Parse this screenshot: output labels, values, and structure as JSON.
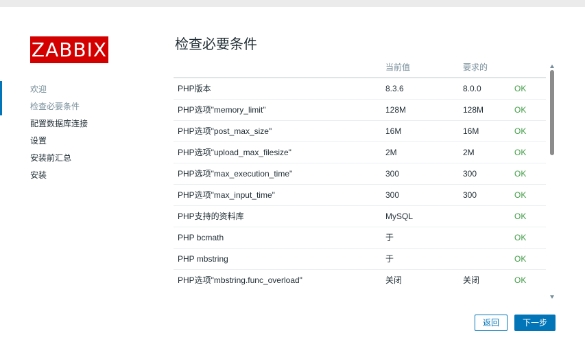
{
  "logo": {
    "text": "ZABBIX",
    "color": "#d40000"
  },
  "steps": [
    {
      "label": "欢迎",
      "state": "done"
    },
    {
      "label": "检查必要条件",
      "state": "current"
    },
    {
      "label": "配置数据库连接",
      "state": "pending"
    },
    {
      "label": "设置",
      "state": "pending"
    },
    {
      "label": "安装前汇总",
      "state": "pending"
    },
    {
      "label": "安装",
      "state": "pending"
    }
  ],
  "page_title": "检查必要条件",
  "table": {
    "headers": [
      "",
      "当前值",
      "要求的",
      ""
    ],
    "rows": [
      {
        "name": "PHP版本",
        "current": "8.3.6",
        "required": "8.0.0",
        "status": "OK"
      },
      {
        "name": "PHP选项\"memory_limit\"",
        "current": "128M",
        "required": "128M",
        "status": "OK"
      },
      {
        "name": "PHP选项\"post_max_size\"",
        "current": "16M",
        "required": "16M",
        "status": "OK"
      },
      {
        "name": "PHP选项\"upload_max_filesize\"",
        "current": "2M",
        "required": "2M",
        "status": "OK"
      },
      {
        "name": "PHP选项\"max_execution_time\"",
        "current": "300",
        "required": "300",
        "status": "OK"
      },
      {
        "name": "PHP选项\"max_input_time\"",
        "current": "300",
        "required": "300",
        "status": "OK"
      },
      {
        "name": "PHP支持的资料库",
        "current": "MySQL",
        "required": "",
        "status": "OK"
      },
      {
        "name": "PHP bcmath",
        "current": "于",
        "required": "",
        "status": "OK"
      },
      {
        "name": "PHP mbstring",
        "current": "于",
        "required": "",
        "status": "OK"
      },
      {
        "name": "PHP选项\"mbstring.func_overload\"",
        "current": "关闭",
        "required": "关闭",
        "status": "OK"
      }
    ]
  },
  "buttons": {
    "back": "返回",
    "next": "下一步"
  },
  "colors": {
    "accent": "#0275b8",
    "ok": "#429e47",
    "muted": "#768d99"
  }
}
